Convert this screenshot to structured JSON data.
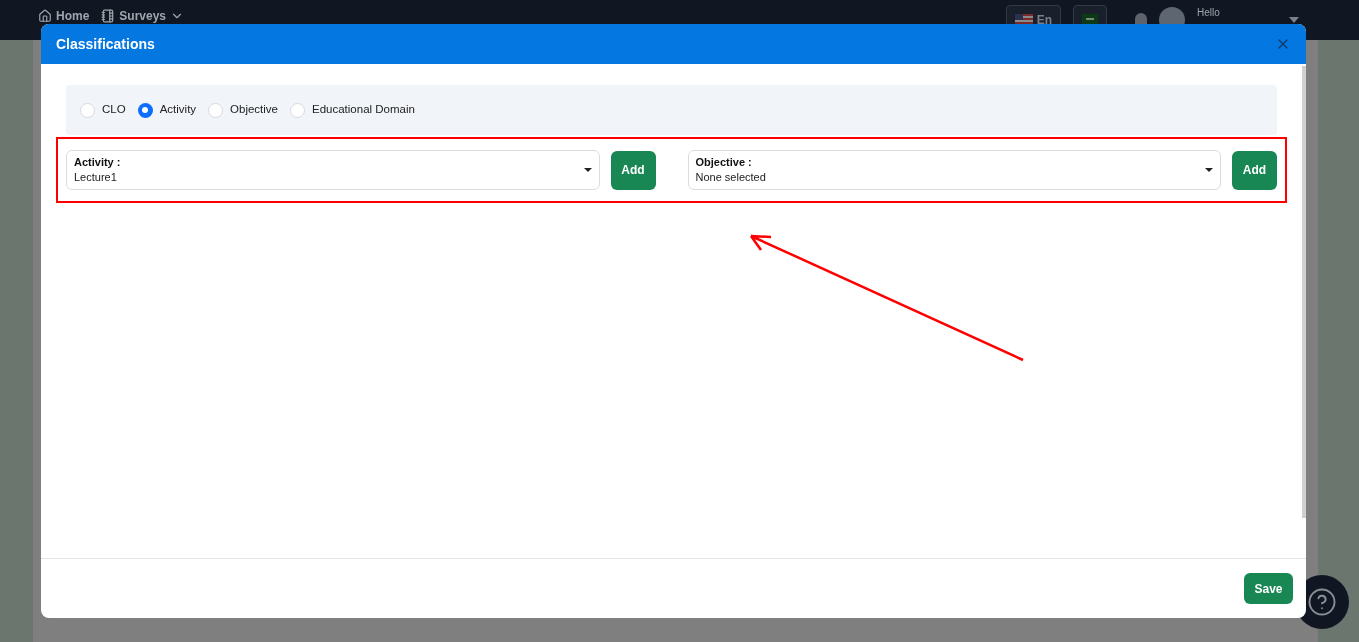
{
  "navbar": {
    "links": [
      {
        "label": "Home",
        "kind": "home"
      },
      {
        "label": "Surveys",
        "kind": "surveys"
      }
    ],
    "language_buttons": [
      {
        "label": "En",
        "kind": "us"
      },
      {
        "kind": "sa"
      }
    ],
    "greeting": "Hello"
  },
  "dialog": {
    "title": "Classifications",
    "radio_options": [
      {
        "label": "CLO",
        "selected": false
      },
      {
        "label": "Activity",
        "selected": true
      },
      {
        "label": "Objective",
        "selected": false
      },
      {
        "label": "Educational Domain",
        "selected": false
      }
    ],
    "selects": [
      {
        "label": "Activity :",
        "value": "Lecture1",
        "button": "Add"
      },
      {
        "label": "Objective :",
        "value": "None selected",
        "button": "Add"
      }
    ],
    "save_button": "Save"
  }
}
